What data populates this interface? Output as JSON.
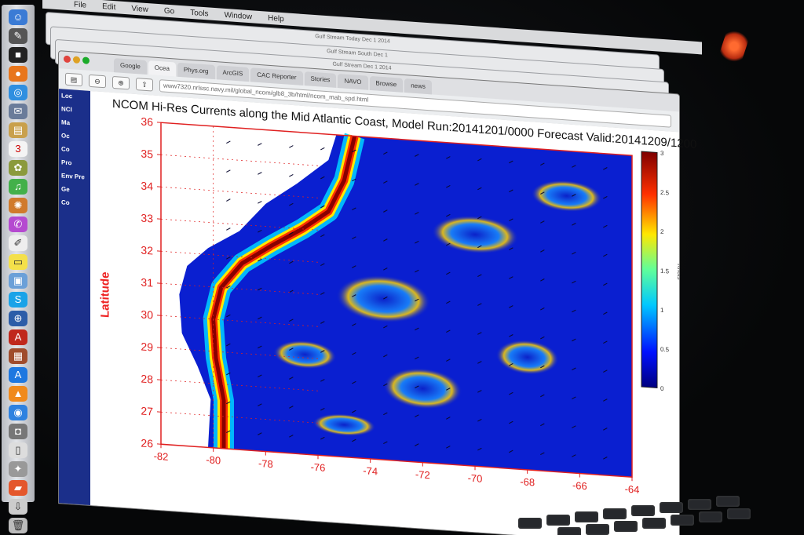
{
  "menubar": {
    "items": [
      "File",
      "Edit",
      "View",
      "Go",
      "Tools",
      "Window",
      "Help"
    ]
  },
  "background_windows": [
    "Gulf Stream Today Dec 1 2014",
    "Gulf Stream South Dec 1",
    "Gulf Stream Dec 1 2014"
  ],
  "browser": {
    "tabs": [
      "Google",
      "Ocea",
      "Phys.org",
      "ArcGIS",
      "CAC Reporter",
      "Stories",
      "NAVO",
      "Browse",
      "news"
    ],
    "active_tab_index": 1,
    "url": "www7320.nrlssc.navy.mil/global_ncom/glb8_3b/html/ncom_mab_spd.html"
  },
  "sidebar": {
    "items": [
      "Loc",
      "NCI",
      "Ma",
      "Oc",
      "Co",
      "Pro",
      "Env Pre",
      "Ge",
      "Co"
    ]
  },
  "chart_data": {
    "type": "heatmap",
    "title": "NCOM Hi-Res Currents along the Mid Atlantic Coast, Model Run:20141201/0000 Forecast Valid:20141209/1200",
    "ylabel": "Latitude",
    "xlabel": "",
    "x_ticks": [
      "-82",
      "-80",
      "-78",
      "-76",
      "-74",
      "-72",
      "-70",
      "-68",
      "-66",
      "-64"
    ],
    "y_ticks": [
      "26",
      "27",
      "28",
      "29",
      "30",
      "31",
      "32",
      "33",
      "34",
      "35",
      "36"
    ],
    "xlim": [
      -82,
      -64
    ],
    "ylim": [
      26,
      36
    ],
    "colorbar": {
      "ticks": [
        "0",
        "0.5",
        "1",
        "1.5",
        "2",
        "2.5",
        "3"
      ],
      "range": [
        0,
        3
      ],
      "label": "Knots",
      "colormap": "jet"
    },
    "features": [
      "Gulf Stream jet along the coast (max speed ~3 knots)",
      "eddies east of the stream",
      "land in white on the west"
    ]
  },
  "colors": {
    "axis": "#e02020",
    "ocean_low": "#0a1fd0",
    "jet_core": "#8a0000"
  }
}
